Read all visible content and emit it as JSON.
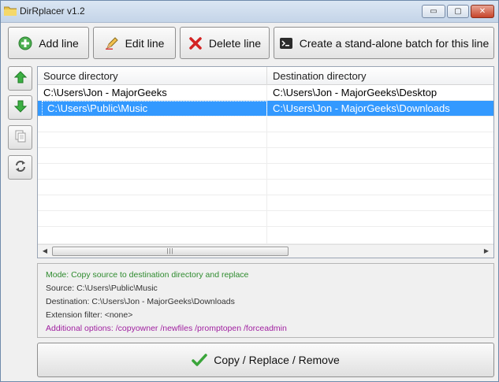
{
  "window": {
    "title": "DirRplacer v1.2",
    "controls": {
      "minimize": "▭",
      "maximize": "▢",
      "close": "✕"
    }
  },
  "toolbar": {
    "add_label": "Add line",
    "edit_label": "Edit line",
    "delete_label": "Delete line",
    "batch_label": "Create a stand-alone batch for this line"
  },
  "side_buttons": [
    "move-up-icon",
    "move-down-icon",
    "copy-icon",
    "swap-icon"
  ],
  "list": {
    "columns": [
      "Source directory",
      "Destination directory"
    ],
    "rows": [
      {
        "source": "C:\\Users\\Jon - MajorGeeks",
        "destination": "C:\\Users\\Jon - MajorGeeks\\Desktop",
        "selected": false
      },
      {
        "source": "C:\\Users\\Public\\Music",
        "destination": "C:\\Users\\Jon - MajorGeeks\\Downloads",
        "selected": true
      }
    ]
  },
  "info": {
    "mode": "Mode: Copy source to destination directory and replace",
    "source": "Source: C:\\Users\\Public\\Music",
    "destination": "Destination: C:\\Users\\Jon - MajorGeeks\\Downloads",
    "extension_filter": "Extension filter: <none>",
    "additional_options": "Additional options: /copyowner /newfiles /promptopen /forceadmin"
  },
  "main_action": {
    "label": "Copy / Replace / Remove"
  },
  "colors": {
    "selection": "#3399ff",
    "mode_text": "#2e8b2e",
    "options_text": "#a020a0",
    "info_text": "#333333"
  }
}
